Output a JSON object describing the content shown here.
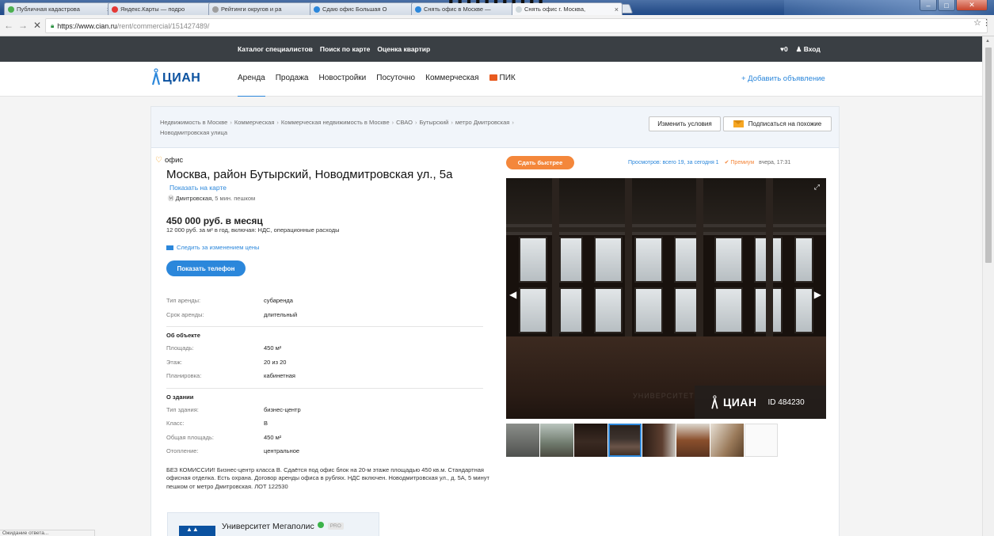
{
  "watermark": "...........",
  "browser": {
    "tabs": [
      {
        "title": "Публичная кадастрова",
        "color": "#4caf50"
      },
      {
        "title": "Яндекс.Карты — подро",
        "color": "#e53935"
      },
      {
        "title": "Рейтинги округов и ра",
        "color": "#9e9e9e"
      },
      {
        "title": "Сдаю офис Большая О",
        "color": "#2b87db"
      },
      {
        "title": "Снять офис в Москве —",
        "color": "#2b87db"
      },
      {
        "title": "Снять офис г. Москва,",
        "color": "#cfd8dc"
      }
    ],
    "url_host": "https://www.cian.ru",
    "url_path": "/rent/commercial/151427489/",
    "status_text": "Ожидание ответа..."
  },
  "topbar": {
    "links": [
      "Каталог специалистов",
      "Поиск по карте",
      "Оценка квартир"
    ],
    "favorites": "♥0",
    "login": "♟ Вход"
  },
  "nav": {
    "logo_text": "ЦИАН",
    "items": [
      "Аренда",
      "Продажа",
      "Новостройки",
      "Посуточно",
      "Коммерческая"
    ],
    "pik": "ПИК",
    "add_ad": "+ Добавить объявление"
  },
  "breadcrumbs": [
    "Недвижимость в Москве",
    "Коммерческая",
    "Коммерческая недвижимость в Москве",
    "СВАО",
    "Бутырский",
    "метро Дмитровская",
    "Новодмитровская улица"
  ],
  "actions": {
    "change": "Изменить условия",
    "subscribe": "Подписаться на похожие"
  },
  "listing": {
    "type": "офис",
    "address": "Москва, район Бутырский, Новодмитровская ул., 5а",
    "show_map": "Показать на карте",
    "metro_station": "Дмитровская,",
    "metro_walk": " 5 мин. пешком",
    "price": "450 000 руб. в месяц",
    "price_sub": "12 000 руб. за м² в год, включая: НДС, операционные расходы",
    "follow_price": "Следить за изменением цены",
    "show_phone": "Показать телефон",
    "rent": [
      {
        "k": "Тип аренды:",
        "v": "субаренда"
      },
      {
        "k": "Срок аренды:",
        "v": "длительный"
      }
    ],
    "object_title": "Об объекте",
    "object": [
      {
        "k": "Площадь:",
        "v": "450 м²"
      },
      {
        "k": "Этаж:",
        "v": "20 из 20"
      },
      {
        "k": "Планировка:",
        "v": "кабинетная"
      }
    ],
    "building_title": "О здании",
    "building": [
      {
        "k": "Тип здания:",
        "v": "бизнес-центр"
      },
      {
        "k": "Класс:",
        "v": "B"
      },
      {
        "k": "Общая площадь:",
        "v": "450 м²"
      },
      {
        "k": "Отопление:",
        "v": "центральное"
      }
    ],
    "description": "БЕЗ КОМИССИИ! Бизнес-центр класса В. Сдаётся под офис блок на 20-м этаже площадью 450 кв.м. Стандартная офисная отделка. Есть охрана. Договор аренды офиса в рублях. НДС включен. Новодмитровская ул., д. 5А, 5 минут пешком от метро Дмитровская. ЛОТ 122530",
    "agent_name": "Университет Мегаполис",
    "agent_pro": "PRO"
  },
  "media": {
    "rent_faster": "Сдать быстрее",
    "views": "Просмотров: всего 19, за сегодня 1",
    "premium": "Премиум",
    "published": "вчера, 17:31",
    "badge_logo": "ЦИАН",
    "badge_id": "ID 484230",
    "photo_watermark": "УНИВЕРСИТЕТ",
    "thumbs": [
      "#6b6b6b",
      "#7d8a7a",
      "#2a1e18",
      "#3a2e28",
      "#4a3028",
      "#6b3e28",
      "#8a6a48",
      "#f4f4f4"
    ]
  }
}
